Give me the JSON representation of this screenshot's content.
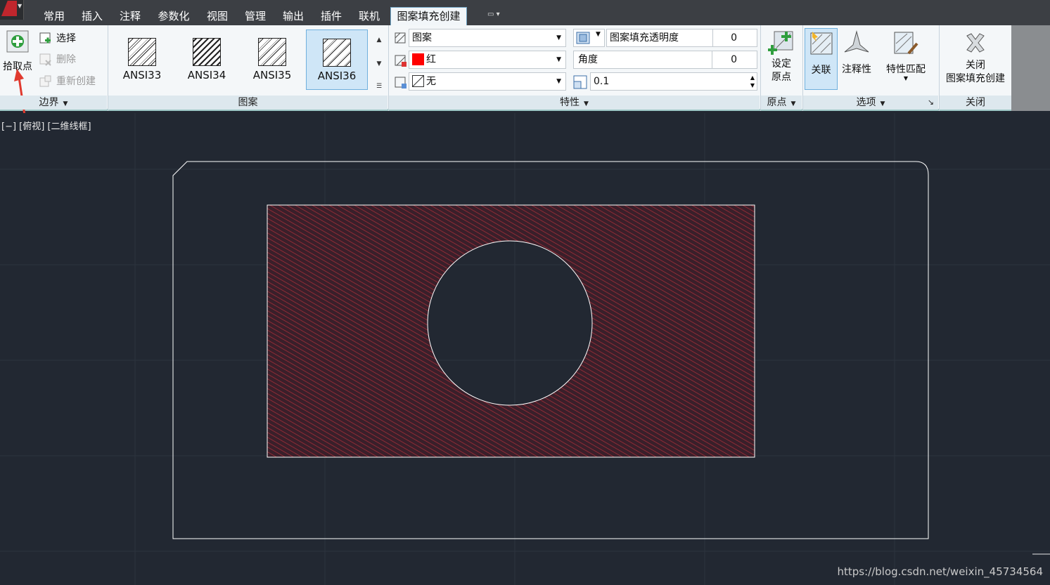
{
  "tabs": [
    {
      "label": "常用",
      "active": false
    },
    {
      "label": "插入",
      "active": false
    },
    {
      "label": "注释",
      "active": false
    },
    {
      "label": "参数化",
      "active": false
    },
    {
      "label": "视图",
      "active": false
    },
    {
      "label": "管理",
      "active": false
    },
    {
      "label": "输出",
      "active": false
    },
    {
      "label": "插件",
      "active": false
    },
    {
      "label": "联机",
      "active": false
    },
    {
      "label": "图案填充创建",
      "active": true
    }
  ],
  "boundary": {
    "title": "边界",
    "pick_points": "拾取点",
    "select": "选择",
    "remove": "删除",
    "recreate": "重新创建"
  },
  "pattern": {
    "title": "图案",
    "items": [
      "ANSI33",
      "ANSI34",
      "ANSI35",
      "ANSI36"
    ],
    "selected": "ANSI36"
  },
  "properties": {
    "title": "特性",
    "type_value": "图案",
    "color_value": "红",
    "color_hex": "#ff0000",
    "background_value": "无",
    "transparency_label": "图案填充透明度",
    "transparency_value": "0",
    "angle_label": "角度",
    "angle_value": "0",
    "scale_value": "0.1"
  },
  "origin": {
    "title": "原点",
    "set_origin_line1": "设定",
    "set_origin_line2": "原点"
  },
  "options": {
    "title": "选项",
    "associative": "关联",
    "annotative": "注释性",
    "match_properties": "特性匹配"
  },
  "close": {
    "title": "关闭",
    "label_line1": "关闭",
    "label_line2": "图案填充创建"
  },
  "viewport": {
    "label": "[−] [俯视] [二维线框]",
    "hatch_color": "#b0303a"
  },
  "watermark": "https://blog.csdn.net/weixin_45734564"
}
